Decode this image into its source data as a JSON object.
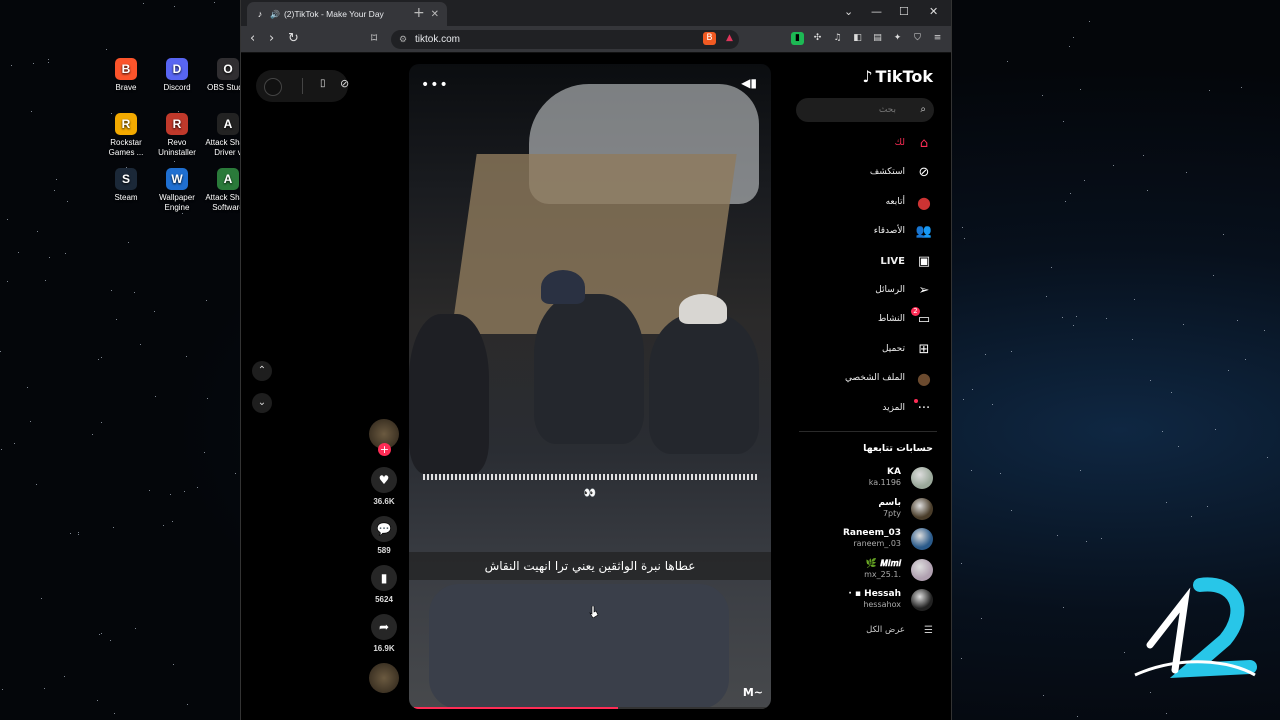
{
  "desktop": {
    "icons": [
      {
        "label": "Brave",
        "color": "#fb542b",
        "glyph": "B"
      },
      {
        "label": "Discord",
        "color": "#5865f2",
        "glyph": "D"
      },
      {
        "label": "OBS Studio",
        "color": "#302e31",
        "glyph": "O"
      },
      {
        "label": "Rockstar Games ...",
        "color": "#f2a900",
        "glyph": "R"
      },
      {
        "label": "Revo Uninstaller",
        "color": "#c0392b",
        "glyph": "R"
      },
      {
        "label": "Attack Shark Driver v",
        "color": "#222",
        "glyph": "A"
      },
      {
        "label": "Steam",
        "color": "#1b2838",
        "glyph": "S"
      },
      {
        "label": "Wallpaper Engine",
        "color": "#1f6fd1",
        "glyph": "W"
      },
      {
        "label": "Attack Shark Software",
        "color": "#2a7a3a",
        "glyph": "A"
      }
    ]
  },
  "browser": {
    "tab_title": "(2)TikTok - Make Your Day",
    "url": "tiktok.com",
    "accent": "#fe2c55"
  },
  "video": {
    "overlay_text": "+++++++++++++++++++++++++++++++++++++++++",
    "emoji_text": "👀 ",
    "caption": "عطاها نبرة الواثقين يعني ترا انهيت النقاش",
    "handle": "M~",
    "progress_fraction": 0.58
  },
  "actions": {
    "likes": "36.6K",
    "comments": "589",
    "saves": "5624",
    "shares": "16.9K"
  },
  "sidebar": {
    "brand": "TikTok",
    "search_placeholder": "بحث",
    "nav": [
      {
        "label": "لك",
        "icon": "home-icon",
        "glyph": "⌂",
        "color": "#fe2c55"
      },
      {
        "label": "استكشف",
        "icon": "compass-icon",
        "glyph": "⊘",
        "color": "#fff"
      },
      {
        "label": "أتابعه",
        "icon": "following-avatar-icon",
        "glyph": "●",
        "color": "#c33"
      },
      {
        "label": "الأصدقاء",
        "icon": "friends-icon",
        "glyph": "👥",
        "color": "#fff"
      },
      {
        "label": "LIVE",
        "icon": "live-icon",
        "glyph": "▣",
        "color": "#fff"
      },
      {
        "label": "الرسائل",
        "icon": "messages-icon",
        "glyph": "➢",
        "color": "#fff"
      },
      {
        "label": "النشاط",
        "icon": "activity-icon",
        "glyph": "▭",
        "color": "#fff",
        "badge": "2"
      },
      {
        "label": "تحميل",
        "icon": "upload-icon",
        "glyph": "⊞",
        "color": "#fff"
      },
      {
        "label": "الملف الشخصي",
        "icon": "profile-avatar-icon",
        "glyph": "●",
        "color": "#6b4a2e"
      },
      {
        "label": "المزيد",
        "icon": "more-icon",
        "glyph": "···",
        "color": "#fff",
        "dot": true
      }
    ],
    "following_title": "حسابات تتابعها",
    "accounts": [
      {
        "name": "KA",
        "handle": "ka.1196",
        "color": "#9aa89a"
      },
      {
        "name": "باسم",
        "handle": "7pty",
        "color": "#4a3d2a"
      },
      {
        "name": "Raneem_03",
        "handle": "raneem_.03",
        "color": "#2a5a8a"
      },
      {
        "name": "𝑴𝒊𝒎𝒊 🌿",
        "handle": "mx_25.1.",
        "color": "#b0a0b0"
      },
      {
        "name": "Hessah ▪ ·",
        "handle": "hessahox",
        "color": "#222"
      }
    ],
    "see_all": "عرض الكل"
  }
}
